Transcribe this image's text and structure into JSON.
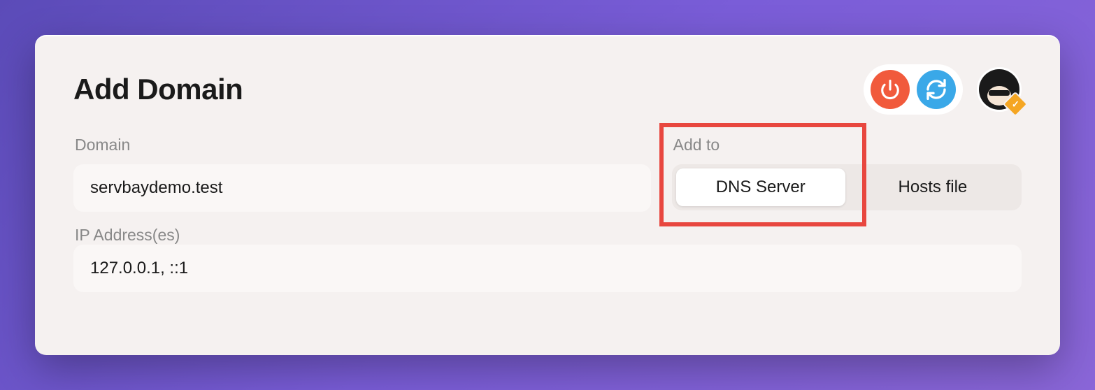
{
  "header": {
    "title": "Add Domain"
  },
  "domain": {
    "label": "Domain",
    "value": "servbaydemo.test"
  },
  "add_to": {
    "label": "Add to",
    "options": {
      "dns_server": "DNS Server",
      "hosts_file": "Hosts file"
    },
    "selected": "dns_server"
  },
  "ip": {
    "label": "IP Address(es)",
    "value": "127.0.0.1, ::1"
  },
  "icons": {
    "power": "power-icon",
    "refresh": "refresh-icon",
    "avatar": "user-avatar"
  }
}
